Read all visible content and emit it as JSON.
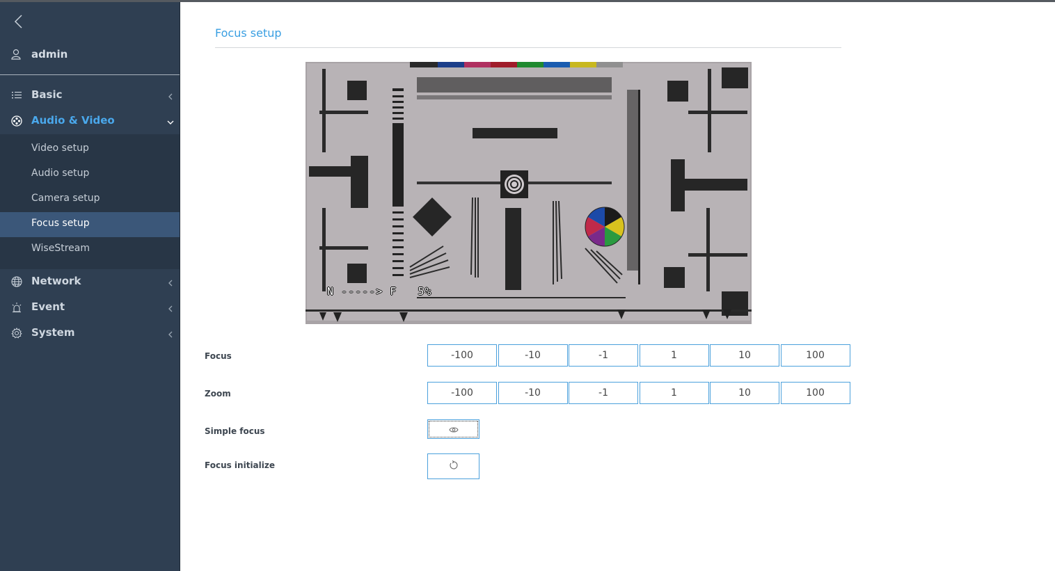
{
  "user": {
    "name": "admin"
  },
  "menu": {
    "basic": "Basic",
    "audio_video": "Audio & Video",
    "sub": {
      "video_setup": "Video setup",
      "audio_setup": "Audio setup",
      "camera_setup": "Camera setup",
      "focus_setup": "Focus setup",
      "wisestream": "WiseStream"
    },
    "network": "Network",
    "event": "Event",
    "system": "System"
  },
  "page": {
    "title": "Focus setup"
  },
  "video": {
    "osd_text": "N -----> F   5%"
  },
  "controls": {
    "focus": {
      "label": "Focus",
      "steps": [
        "-100",
        "-10",
        "-1",
        "1",
        "10",
        "100"
      ]
    },
    "zoom": {
      "label": "Zoom",
      "steps": [
        "-100",
        "-10",
        "-1",
        "1",
        "10",
        "100"
      ]
    },
    "simple_focus": {
      "label": "Simple focus",
      "icon": "eye-icon"
    },
    "focus_initialize": {
      "label": "Focus initialize",
      "icon": "reset-icon"
    }
  },
  "colors": {
    "accent": "#3a9fe2",
    "sidebar_bg": "#2f3f52",
    "selected_bg": "#3b5779",
    "button_border": "#4aa0dc"
  }
}
